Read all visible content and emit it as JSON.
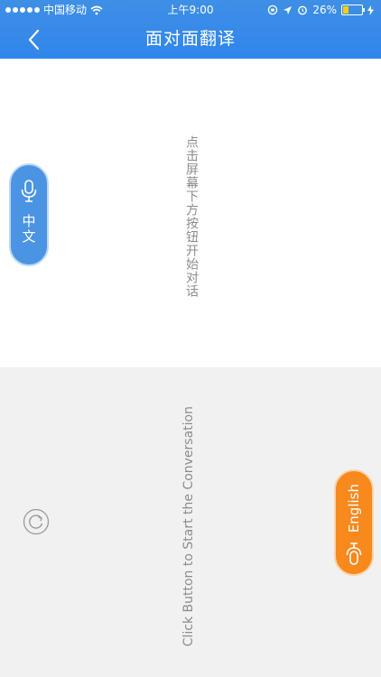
{
  "status_bar": {
    "carrier": "中国移动",
    "time": "上午9:00",
    "battery": "26%",
    "battery_color": "#f5d000"
  },
  "nav": {
    "title": "面对面翻译",
    "back_icon": "chevron-left-icon"
  },
  "top_panel": {
    "hint": "点击屏幕下方按钮开始对话",
    "language_button": {
      "label": "中文",
      "icon": "microphone-icon",
      "color": "#4a94e3"
    }
  },
  "bottom_panel": {
    "hint": "Click Button to Start the Conversation",
    "language_button": {
      "label": "English",
      "icon": "microphone-icon",
      "color": "#f7891d"
    },
    "swap_icon": "rotate-icon"
  }
}
